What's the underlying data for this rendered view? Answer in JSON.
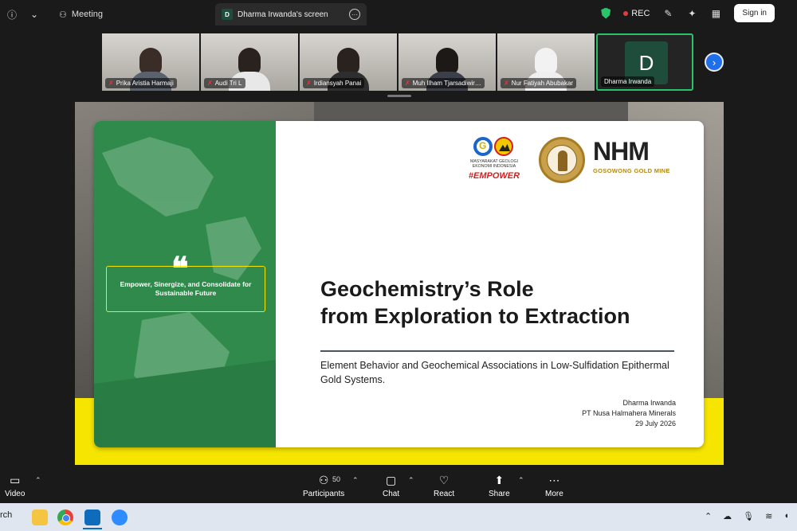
{
  "topbar": {
    "info_icon": "info-icon",
    "chevron": "chevron-down-icon",
    "meeting_label": "Meeting",
    "screen_tab_badge": "D",
    "screen_tab_label": "Dharma Irwanda's screen",
    "rec_label": "REC",
    "signin_label": "Sign in"
  },
  "participants_strip": [
    {
      "name": "Prika Aristia Harmaji"
    },
    {
      "name": "Audi Tri L"
    },
    {
      "name": "Irdiansyah Panai"
    },
    {
      "name": "Muh Ilham Tjarsadiwir…"
    },
    {
      "name": "Nur Fatiyah Abubakar"
    },
    {
      "name": "Dharma Irwanda",
      "initial": "D",
      "active": true
    }
  ],
  "slide": {
    "quote": "Empower, Sinergize, and Consolidate for Sustainable Future",
    "logo_org_text": "MASYARAKAT GEOLOGI EKONOMI INDONESIA",
    "logo_tag": "#EMPOWER",
    "nhm_text": "NHM",
    "nhm_sub": "GOSOWONG GOLD MINE",
    "title_line1": "Geochemistry’s Role",
    "title_line2": "from Exploration to Extraction",
    "subtitle": "Element Behavior and Geochemical Associations in Low-Sulfidation Epithermal Gold Systems.",
    "presenter": "Dharma Irwanda",
    "company": "PT Nusa Halmahera Minerals",
    "date": "29 July 2026"
  },
  "controls": {
    "video": "Video",
    "participants": "Participants",
    "participants_count": "50",
    "chat": "Chat",
    "react": "React",
    "share": "Share",
    "more": "More"
  },
  "taskbar": {
    "search_partial": "rch"
  },
  "colors": {
    "green_panel": "#2f8a4b",
    "accent_yellow": "#f6e500",
    "active_border": "#2bc26b"
  }
}
